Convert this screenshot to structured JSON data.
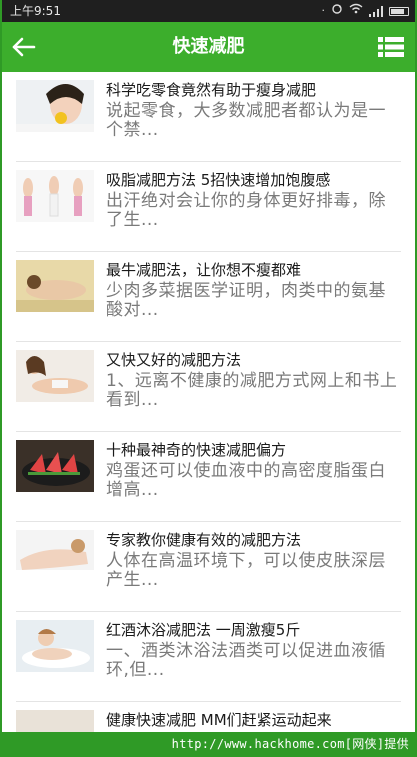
{
  "status_bar": {
    "time": "上午9:51"
  },
  "header": {
    "title": "快速减肥",
    "back_icon": "arrow-left-icon",
    "menu_icon": "list-menu-icon"
  },
  "colors": {
    "header_green": "#3cae2c",
    "frame_green": "#2f9a26",
    "title_text": "#1a1a1a",
    "summary_text": "#7a7a7a"
  },
  "articles": [
    {
      "title": "科学吃零食竟然有助于瘦身减肥",
      "summary": "说起零食，大多数减肥者都认为是一个禁...",
      "thumb": "woman-eating-thumbnail"
    },
    {
      "title": "吸脂减肥方法 5招快速增加饱腹感",
      "summary": "出汗绝对会让你的身体更好排毒，除了生...",
      "thumb": "fitness-women-thumbnail"
    },
    {
      "title": "最牛减肥法，让你想不瘦都难",
      "summary": "少肉多菜据医学证明，肉类中的氨基酸对...",
      "thumb": "spa-woman-thumbnail"
    },
    {
      "title": "又快又好的减肥方法",
      "summary": "1、远离不健康的减肥方式网上和书上看到...",
      "thumb": "reclining-woman-thumbnail"
    },
    {
      "title": "十种最神奇的快速减肥偏方",
      "summary": "鸡蛋还可以使血液中的高密度脂蛋白增高...",
      "thumb": "watermelon-plate-thumbnail"
    },
    {
      "title": "专家教你健康有效的减肥方法",
      "summary": "人体在高温环境下，可以使皮肤深层产生...",
      "thumb": "lying-woman-thumbnail"
    },
    {
      "title": "红酒沐浴减肥法 一周激瘦5斤",
      "summary": "一、酒类沐浴法酒类可以促进血液循环,但...",
      "thumb": "bath-woman-thumbnail"
    },
    {
      "title": "健康快速减肥 MM们赶紧运动起来",
      "summary": "",
      "thumb": "partial-thumbnail"
    }
  ],
  "watermark": {
    "text": "http://www.hackhome.com[网侠]提供"
  }
}
